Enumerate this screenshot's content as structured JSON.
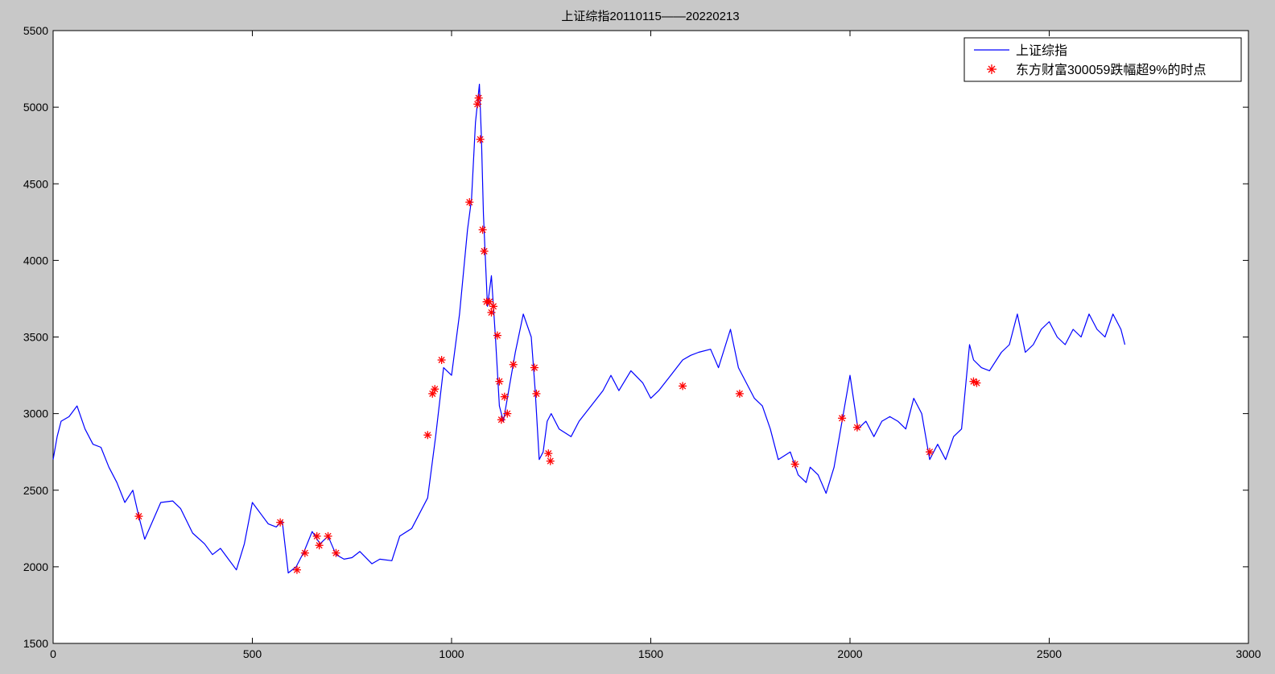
{
  "chart_data": {
    "type": "line",
    "title": "上证综指20110115——20220213",
    "xlabel": "",
    "ylabel": "",
    "xlim": [
      0,
      3000
    ],
    "ylim": [
      1500,
      5500
    ],
    "xticks": [
      0,
      500,
      1000,
      1500,
      2000,
      2500,
      3000
    ],
    "yticks": [
      1500,
      2000,
      2500,
      3000,
      3500,
      4000,
      4500,
      5000,
      5500
    ],
    "grid": false,
    "legend_position": "top-right",
    "series": [
      {
        "name": "上证综指",
        "kind": "line",
        "color": "#0000ff",
        "x": [
          0,
          10,
          20,
          40,
          60,
          80,
          100,
          120,
          140,
          160,
          180,
          200,
          215,
          230,
          250,
          270,
          300,
          320,
          350,
          380,
          400,
          420,
          440,
          460,
          480,
          500,
          520,
          540,
          560,
          575,
          590,
          610,
          630,
          650,
          670,
          690,
          710,
          730,
          750,
          770,
          800,
          820,
          850,
          870,
          900,
          920,
          940,
          960,
          980,
          1000,
          1020,
          1040,
          1050,
          1060,
          1070,
          1075,
          1080,
          1090,
          1100,
          1110,
          1120,
          1130,
          1140,
          1160,
          1180,
          1200,
          1210,
          1220,
          1230,
          1240,
          1250,
          1270,
          1300,
          1320,
          1350,
          1380,
          1400,
          1420,
          1450,
          1480,
          1500,
          1520,
          1550,
          1580,
          1600,
          1620,
          1650,
          1670,
          1700,
          1720,
          1740,
          1760,
          1780,
          1800,
          1820,
          1850,
          1870,
          1890,
          1900,
          1920,
          1940,
          1960,
          1980,
          2000,
          2020,
          2040,
          2060,
          2080,
          2100,
          2120,
          2140,
          2160,
          2180,
          2200,
          2220,
          2240,
          2260,
          2280,
          2300,
          2310,
          2330,
          2350,
          2380,
          2400,
          2420,
          2440,
          2460,
          2480,
          2500,
          2520,
          2540,
          2560,
          2580,
          2600,
          2620,
          2640,
          2660,
          2680,
          2690
        ],
        "y": [
          2700,
          2850,
          2950,
          2980,
          3050,
          2900,
          2800,
          2780,
          2650,
          2550,
          2420,
          2500,
          2330,
          2180,
          2300,
          2420,
          2430,
          2380,
          2220,
          2150,
          2080,
          2120,
          2050,
          1980,
          2150,
          2420,
          2350,
          2280,
          2260,
          2300,
          1960,
          2000,
          2100,
          2230,
          2150,
          2200,
          2080,
          2050,
          2060,
          2100,
          2020,
          2050,
          2040,
          2200,
          2250,
          2350,
          2450,
          2850,
          3300,
          3250,
          3650,
          4200,
          4400,
          4900,
          5150,
          4800,
          4300,
          3700,
          3900,
          3500,
          3050,
          2950,
          3100,
          3400,
          3650,
          3500,
          3150,
          2700,
          2750,
          2950,
          3000,
          2900,
          2850,
          2950,
          3050,
          3150,
          3250,
          3150,
          3280,
          3200,
          3100,
          3150,
          3250,
          3350,
          3380,
          3400,
          3420,
          3300,
          3550,
          3300,
          3200,
          3100,
          3050,
          2900,
          2700,
          2750,
          2600,
          2550,
          2650,
          2600,
          2480,
          2650,
          2950,
          3250,
          2900,
          2950,
          2850,
          2950,
          2980,
          2950,
          2900,
          3100,
          3000,
          2700,
          2800,
          2700,
          2850,
          2900,
          3450,
          3350,
          3300,
          3280,
          3400,
          3450,
          3650,
          3400,
          3450,
          3550,
          3600,
          3500,
          3450,
          3550,
          3500,
          3650,
          3550,
          3500,
          3650,
          3550,
          3450
        ]
      },
      {
        "name": "东方财富300059跌幅超9%的时点",
        "kind": "scatter",
        "marker": "*",
        "color": "#ff0000",
        "x": [
          215,
          570,
          612,
          632,
          662,
          668,
          690,
          710,
          940,
          952,
          958,
          975,
          1045,
          1065,
          1068,
          1072,
          1078,
          1082,
          1088,
          1095,
          1100,
          1105,
          1115,
          1120,
          1125,
          1133,
          1140,
          1155,
          1208,
          1213,
          1243,
          1248,
          1580,
          1723,
          1862,
          1980,
          2018,
          2200,
          2310,
          2318
        ],
        "y": [
          2330,
          2290,
          1980,
          2090,
          2200,
          2140,
          2200,
          2090,
          2860,
          3130,
          3160,
          3350,
          4380,
          5020,
          5060,
          4790,
          4200,
          4060,
          3730,
          3730,
          3660,
          3700,
          3510,
          3210,
          2960,
          3110,
          3000,
          3320,
          3300,
          3130,
          2740,
          2690,
          3180,
          3130,
          2670,
          2970,
          2910,
          2750,
          3210,
          3200
        ]
      }
    ]
  },
  "legend": {
    "line_label": "上证综指",
    "marker_label": "东方财富300059跌幅超9%的时点"
  }
}
